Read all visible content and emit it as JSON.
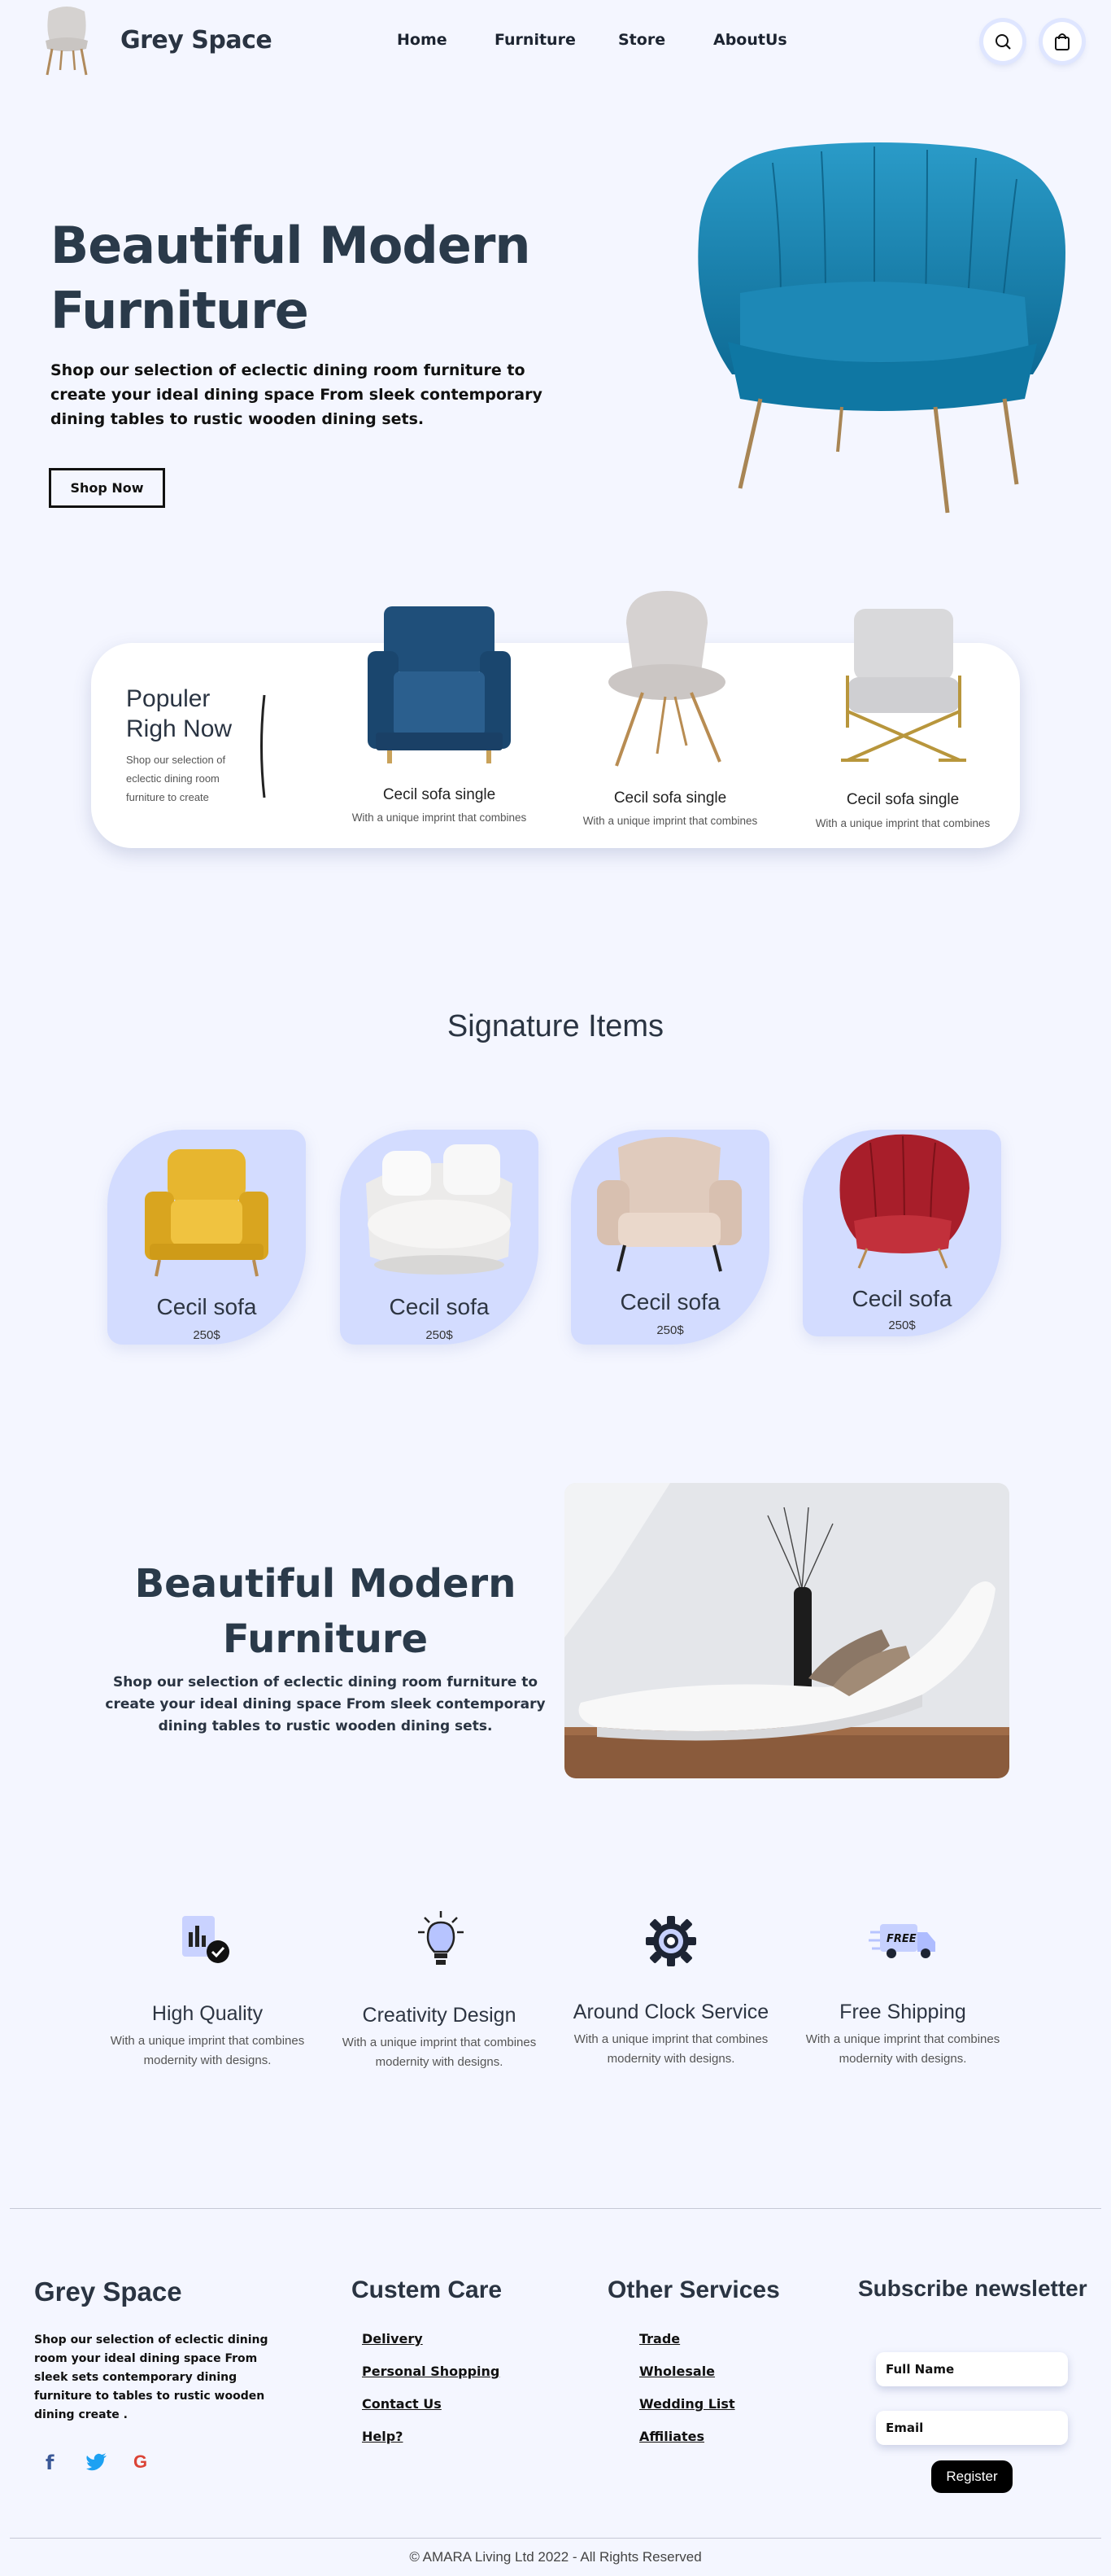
{
  "header": {
    "brand": "Grey Space",
    "nav": [
      "Home",
      "Furniture",
      "Store",
      "AboutUs"
    ]
  },
  "hero": {
    "title": "Beautiful Modern Furniture",
    "subtitle": "Shop our selection of eclectic dining room furniture to create your ideal dining space From sleek contemporary dining tables to rustic wooden dining sets.",
    "button": "Shop Now"
  },
  "popular": {
    "title_line1": "Populer",
    "title_line2": "Righ Now",
    "desc": "Shop our selection of eclectic dining room furniture to create",
    "items": [
      {
        "name": "Cecil sofa single",
        "desc": "With a unique imprint that combines"
      },
      {
        "name": "Cecil sofa single",
        "desc": "With a unique imprint that combines"
      },
      {
        "name": "Cecil sofa single",
        "desc": "With a unique imprint that combines"
      }
    ]
  },
  "signature": {
    "heading": "Signature Items",
    "items": [
      {
        "name": "Cecil sofa",
        "price": "250$"
      },
      {
        "name": "Cecil sofa",
        "price": "250$"
      },
      {
        "name": "Cecil sofa",
        "price": "250$"
      },
      {
        "name": "Cecil sofa",
        "price": "250$"
      }
    ]
  },
  "promo": {
    "title": "Beautiful Modern Furniture",
    "subtitle": "Shop our selection of eclectic dining room furniture to create your ideal dining space From sleek contemporary dining tables to rustic wooden dining sets."
  },
  "features": [
    {
      "title": "High Quality",
      "desc": "With a unique imprint that combines modernity with designs."
    },
    {
      "title": "Creativity Design",
      "desc": "With a unique imprint that combines modernity with designs."
    },
    {
      "title": "Around Clock Service",
      "desc": "With a unique imprint that combines modernity with designs."
    },
    {
      "title": "Free Shipping",
      "desc": "With a unique imprint that combines modernity with designs.",
      "badge": "FREE"
    }
  ],
  "footer": {
    "brand": "Grey Space",
    "desc": "Shop our selection of eclectic dining room your ideal dining space From sleek sets contemporary dining furniture to tables to rustic wooden dining create .",
    "custem_care": {
      "heading": "Custem Care",
      "links": [
        "Delivery",
        "Personal Shopping",
        "Contact Us",
        "Help?"
      ]
    },
    "other_services": {
      "heading": "Other Services",
      "links": [
        "Trade",
        "Wholesale",
        "Wedding List",
        "Affiliates"
      ]
    },
    "newsletter": {
      "heading": "Subscribe newsletter",
      "name_placeholder": "Full Name",
      "email_placeholder": "Email",
      "button": "Register"
    },
    "social": [
      "facebook-icon",
      "twitter-icon",
      "google-icon"
    ],
    "copyright": "© AMARA Living Ltd 2022 - All Rights Reserved"
  },
  "colors": {
    "background": "#f4f6ff",
    "card": "#d3dcff",
    "heading": "#2a3442",
    "accent_blue": "#1e8fbf"
  }
}
